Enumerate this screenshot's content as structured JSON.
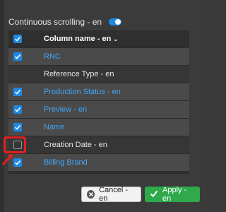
{
  "settings": {
    "continuous_scrolling_label": "Continuous scrolling - en",
    "continuous_scrolling_on": true
  },
  "table": {
    "header": {
      "label": "Column name - en",
      "checked": true
    },
    "rows": [
      {
        "label": "RNC",
        "checked": true,
        "style": "link"
      },
      {
        "label": "Reference Type - en",
        "checked": false,
        "style": "plain",
        "checkbox_visible": false
      },
      {
        "label": "Production Status - en",
        "checked": true,
        "style": "link"
      },
      {
        "label": "Preview - en",
        "checked": true,
        "style": "link"
      },
      {
        "label": "Name",
        "checked": true,
        "style": "link"
      },
      {
        "label": "Creation Date - en",
        "checked": false,
        "style": "plain"
      },
      {
        "label": "Billing Brand",
        "checked": true,
        "style": "link"
      }
    ]
  },
  "footer": {
    "cancel_label": "Cancel - en",
    "apply_label": "Apply - en"
  },
  "colors": {
    "accent": "#1e88e5",
    "link": "#42a5f5",
    "apply": "#2ea94b",
    "highlight": "#e02020"
  }
}
